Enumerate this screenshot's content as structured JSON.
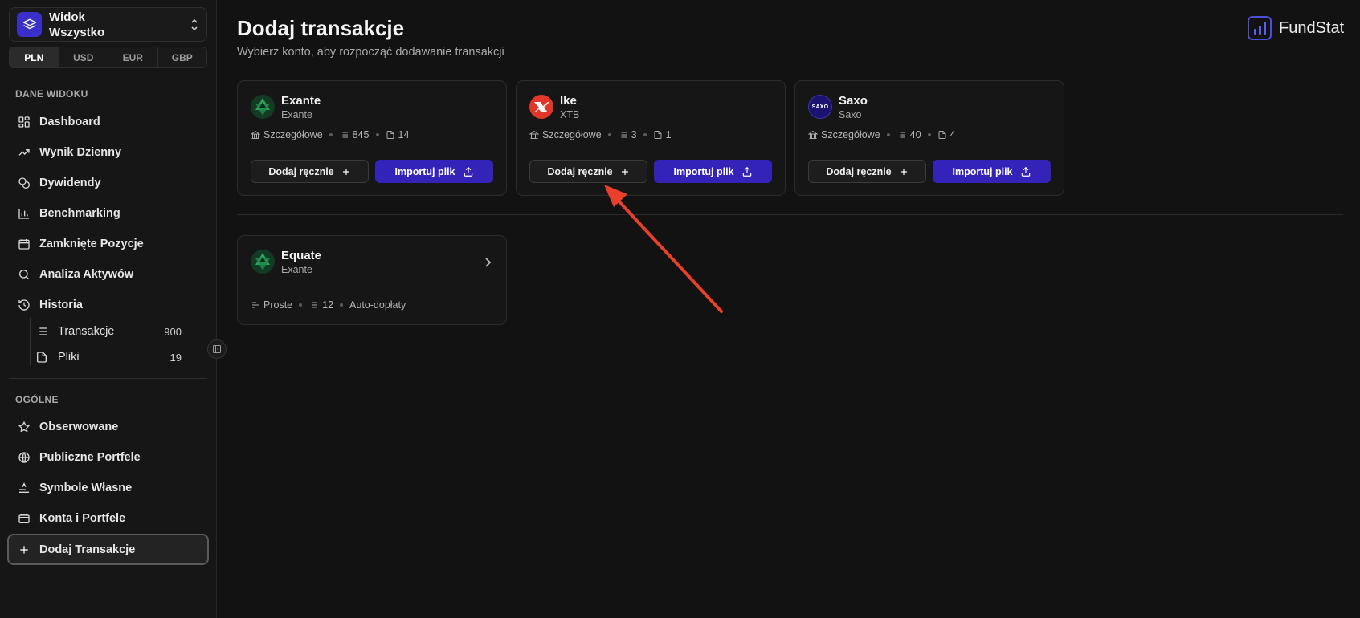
{
  "sidebar": {
    "view": {
      "line1": "Widok",
      "line2": "Wszystko",
      "icon": "layers-icon"
    },
    "currencies": [
      "PLN",
      "USD",
      "EUR",
      "GBP"
    ],
    "active_currency": "PLN",
    "section1": "DANE WIDOKU",
    "items": [
      {
        "label": "Dashboard",
        "icon": "dashboard-icon"
      },
      {
        "label": "Wynik Dzienny",
        "icon": "trend-icon"
      },
      {
        "label": "Dywidendy",
        "icon": "coins-icon"
      },
      {
        "label": "Benchmarking",
        "icon": "bar-chart-icon"
      },
      {
        "label": "Zamknięte Pozycje",
        "icon": "calendar-icon"
      },
      {
        "label": "Analiza Aktywów",
        "icon": "search-icon"
      },
      {
        "label": "Historia",
        "icon": "history-icon"
      }
    ],
    "sub_items": [
      {
        "label": "Transakcje",
        "count": "900",
        "icon": "list-icon"
      },
      {
        "label": "Pliki",
        "count": "19",
        "icon": "file-icon"
      }
    ],
    "section2": "OGÓLNE",
    "items2": [
      {
        "label": "Obserwowane",
        "icon": "star-icon"
      },
      {
        "label": "Publiczne Portfele",
        "icon": "globe-icon"
      },
      {
        "label": "Symbole Własne",
        "icon": "text-align-icon"
      },
      {
        "label": "Konta i Portfele",
        "icon": "wallet-icon"
      },
      {
        "label": "Dodaj Transakcje",
        "icon": "plus-icon"
      }
    ]
  },
  "header": {
    "title": "Dodaj transakcje",
    "subtitle": "Wybierz konto, aby rozpocząć dodawanie transakcji",
    "brand": "FundStat"
  },
  "accounts": [
    {
      "name": "Exante",
      "broker": "Exante",
      "mode": "Szczegółowe",
      "transactions": "845",
      "files": "14",
      "logo": "exante-logo"
    },
    {
      "name": "Ike",
      "broker": "XTB",
      "mode": "Szczegółowe",
      "transactions": "3",
      "files": "1",
      "logo": "xtb-logo"
    },
    {
      "name": "Saxo",
      "broker": "Saxo",
      "mode": "Szczegółowe",
      "transactions": "40",
      "files": "4",
      "logo": "saxo-logo",
      "logo_text": "SAXO"
    }
  ],
  "buttons": {
    "manual": "Dodaj ręcznie",
    "import": "Importuj plik"
  },
  "simple_accounts": [
    {
      "name": "Equate",
      "broker": "Exante",
      "mode": "Proste",
      "transactions": "12",
      "extra": "Auto-dopłaty",
      "logo": "exante-logo"
    }
  ],
  "colors": {
    "accent": "#3323b8",
    "annotation_arrow": "#e8402a",
    "xtb": "#e2362a",
    "exante": "#1f8a4c",
    "saxo": "#1a1470"
  }
}
